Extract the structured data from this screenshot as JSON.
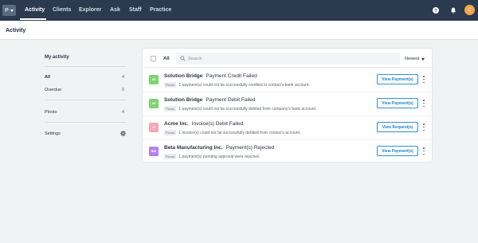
{
  "nav": {
    "logo_letter": "P",
    "items": [
      {
        "label": "Activity"
      },
      {
        "label": "Clients"
      },
      {
        "label": "Explorer"
      },
      {
        "label": "Ask"
      },
      {
        "label": "Staff"
      },
      {
        "label": "Practice"
      }
    ],
    "active": "Activity",
    "icons": [
      "help-icon",
      "bell-icon"
    ],
    "avatar_letter": "C",
    "colors": {
      "bar": "#2b3a4e",
      "avatar": "#f5a54a"
    }
  },
  "page": {
    "title": "Activity"
  },
  "sidebar": {
    "title": "My activity",
    "filters": [
      {
        "label": "All",
        "count": "4"
      },
      {
        "label": "Overdue",
        "count": "0"
      }
    ],
    "groups": [
      {
        "label": "Plooto",
        "count": "4"
      }
    ],
    "settings_label": "Settings"
  },
  "feed": {
    "select_all_label": "All",
    "search_placeholder": "Search",
    "sort_label": "Newest",
    "items": [
      {
        "badge": "SB",
        "badge_color": "#7ed36b",
        "company": "Solution Bridge",
        "event": "Payment Credit Failed",
        "tag": "Plooto",
        "description": "1 payment(s) could not be successfully credited to contact's bank account.",
        "action": "View Payment(s)"
      },
      {
        "badge": "SB",
        "badge_color": "#7ed36b",
        "company": "Solution Bridge",
        "event": "Payment Debit Failed",
        "tag": "Plooto",
        "description": "1 payment(s) could not be successfully debited from company's bank account.",
        "action": "View Payment(s)"
      },
      {
        "badge": "AI",
        "badge_color": "#f3a9b9",
        "company": "Acme Inc.",
        "event": "Invoice(s) Debit Failed",
        "tag": "Plooto",
        "description": "1 invoice(s) could not be successfully debited from contact's account.",
        "action": "View Request(s)"
      },
      {
        "badge": "BMI",
        "badge_color": "#b084e8",
        "company": "Beta Manufacturing Inc.",
        "event": "Payment(s) Rejected",
        "tag": "Plooto",
        "description": "1 payment(s) pending approval were rejected.",
        "action": "View Payment(s)"
      }
    ]
  }
}
